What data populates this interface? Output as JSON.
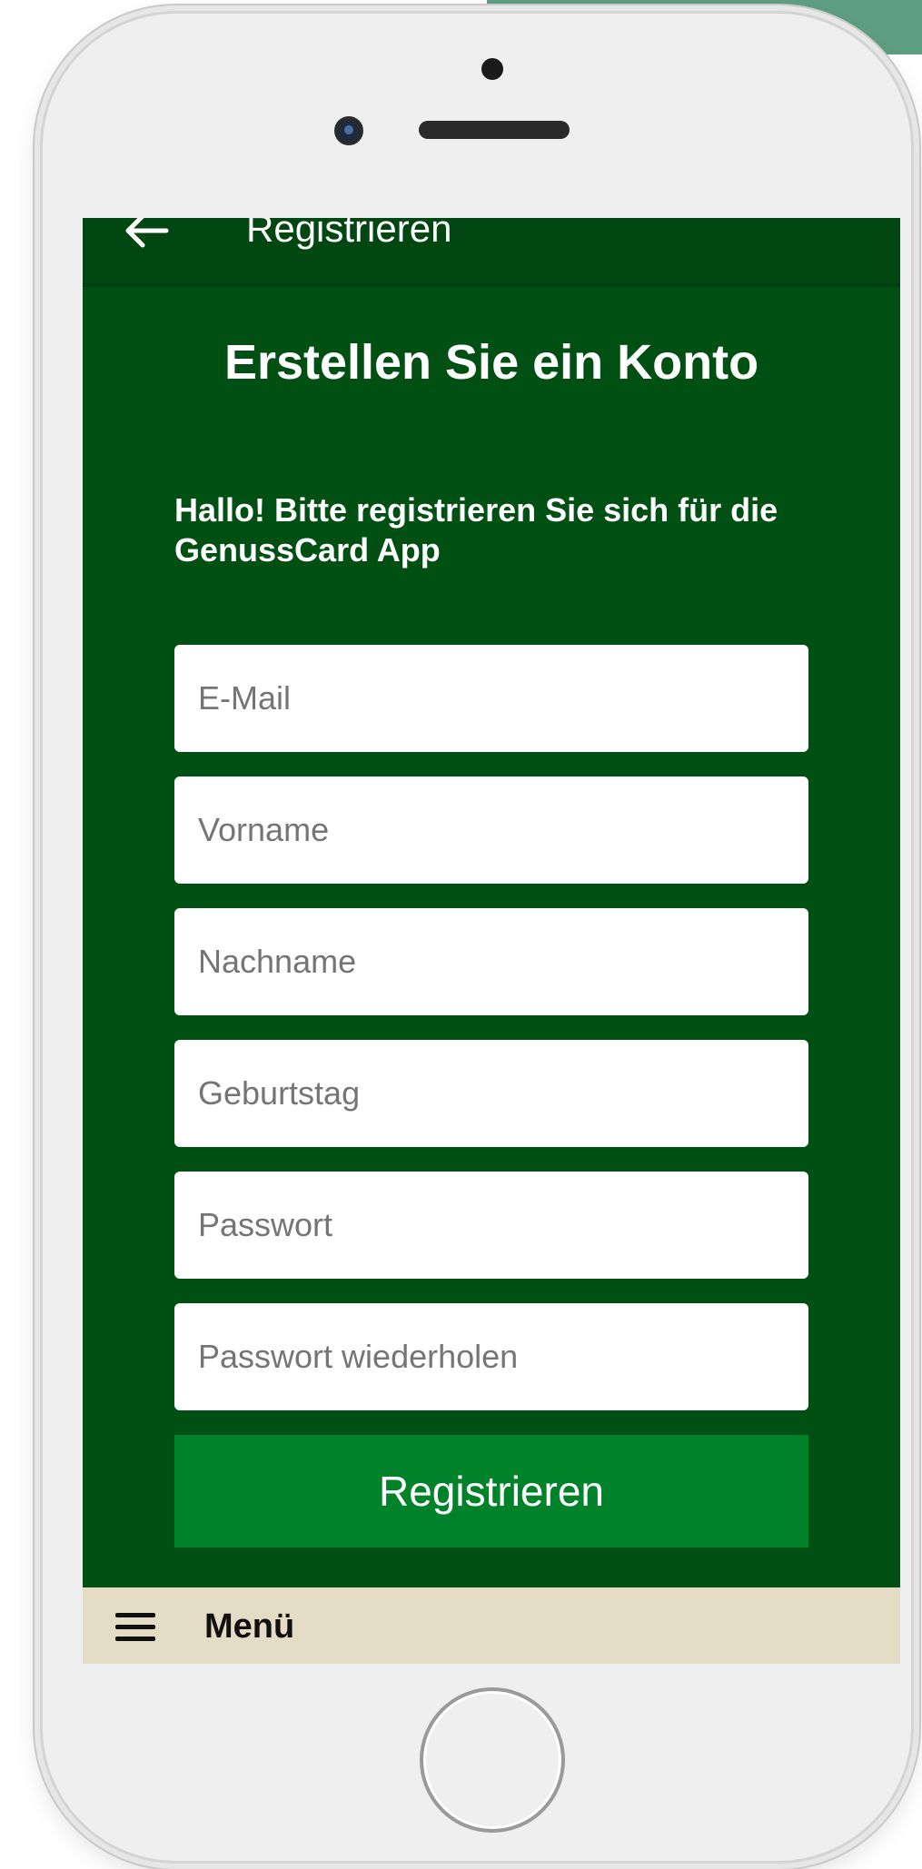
{
  "app_bar": {
    "title": "Registrieren",
    "back_icon": "arrow-left-icon"
  },
  "form": {
    "heading": "Erstellen Sie ein Konto",
    "intro": "Hallo! Bitte registrieren Sie sich für die GenussCard App",
    "email_placeholder": "E-Mail",
    "firstname_placeholder": "Vorname",
    "lastname_placeholder": "Nachname",
    "birthday_placeholder": "Geburtstag",
    "password_placeholder": "Passwort",
    "password_repeat_placeholder": "Passwort wiederholen",
    "submit_label": "Registrieren"
  },
  "bottom_bar": {
    "menu_label": "Menü",
    "menu_icon": "hamburger-icon"
  },
  "colors": {
    "primary_green": "#004f13",
    "button_green": "#00822a",
    "bottom_bar": "#e4dcc4",
    "accent_background": "#5e9e82"
  }
}
